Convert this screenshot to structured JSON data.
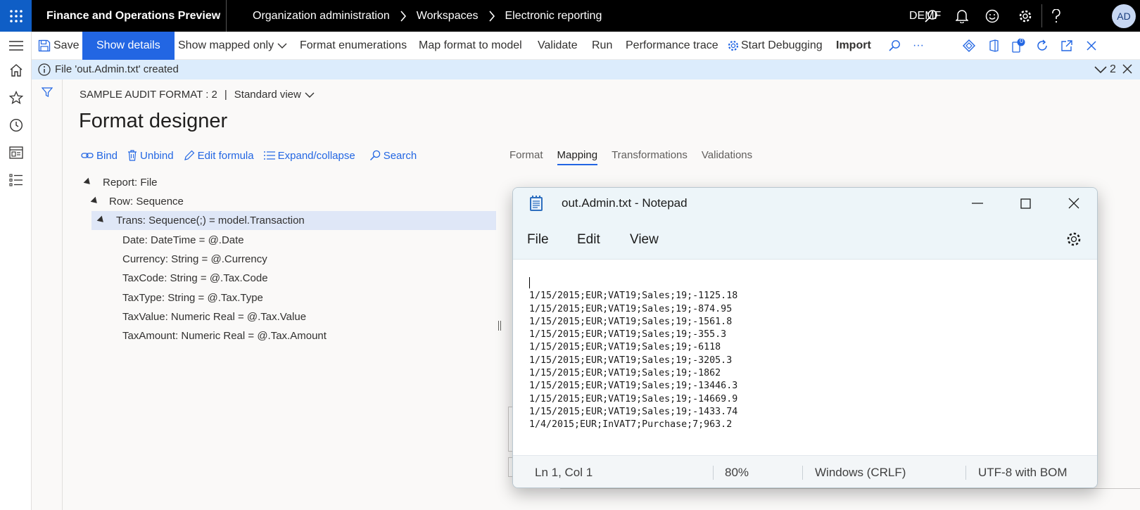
{
  "topbar": {
    "app_title": "Finance and Operations Preview",
    "breadcrumb": [
      "Organization administration",
      "Workspaces",
      "Electronic reporting"
    ],
    "company": "DEMF",
    "avatar": "AD"
  },
  "actions": {
    "save": "Save",
    "show_details": "Show details",
    "show_mapped_only": "Show mapped only",
    "format_enumerations": "Format enumerations",
    "map_format_to_model": "Map format to model",
    "validate": "Validate",
    "run": "Run",
    "performance_trace": "Performance trace",
    "start_debugging": "Start Debugging",
    "import": "Import",
    "more": "···",
    "badge_count": "0"
  },
  "message": {
    "text": "File 'out.Admin.txt' created",
    "count": "2"
  },
  "header": {
    "format_name": "SAMPLE AUDIT FORMAT : 2",
    "separator": "|",
    "view": "Standard view"
  },
  "page_title": "Format designer",
  "tree_toolbar": {
    "bind": "Bind",
    "unbind": "Unbind",
    "edit_formula": "Edit formula",
    "expand_collapse": "Expand/collapse",
    "search": "Search"
  },
  "tree": [
    {
      "label": "Report: File",
      "expanded": true
    },
    {
      "label": "Row: Sequence",
      "expanded": true
    },
    {
      "label": "Trans: Sequence(;) = model.Transaction",
      "expanded": true,
      "selected": true
    },
    {
      "label": "Date: DateTime = @.Date"
    },
    {
      "label": "Currency: String = @.Currency"
    },
    {
      "label": "TaxCode: String = @.Tax.Code"
    },
    {
      "label": "TaxType: String = @.Tax.Type"
    },
    {
      "label": "TaxValue: Numeric Real = @.Tax.Value"
    },
    {
      "label": "TaxAmount: Numeric Real = @.Tax.Amount"
    }
  ],
  "tabs": [
    {
      "label": "Format",
      "active": false
    },
    {
      "label": "Mapping",
      "active": true
    },
    {
      "label": "Transformations",
      "active": false
    },
    {
      "label": "Validations",
      "active": false
    }
  ],
  "notepad": {
    "title": "out.Admin.txt - Notepad",
    "menu": [
      "File",
      "Edit",
      "View"
    ],
    "lines": [
      "1/15/2015;EUR;VAT19;Sales;19;-1125.18",
      "1/15/2015;EUR;VAT19;Sales;19;-874.95",
      "1/15/2015;EUR;VAT19;Sales;19;-1561.8",
      "1/15/2015;EUR;VAT19;Sales;19;-355.3",
      "1/15/2015;EUR;VAT19;Sales;19;-6118",
      "1/15/2015;EUR;VAT19;Sales;19;-3205.3",
      "1/15/2015;EUR;VAT19;Sales;19;-1862",
      "1/15/2015;EUR;VAT19;Sales;19;-13446.3",
      "1/15/2015;EUR;VAT19;Sales;19;-14669.9",
      "1/15/2015;EUR;VAT19;Sales;19;-1433.74",
      "1/4/2015;EUR;InVAT7;Purchase;7;963.2"
    ],
    "status": {
      "position": "Ln 1, Col 1",
      "zoom": "80%",
      "line_ending": "Windows (CRLF)",
      "encoding": "UTF-8 with BOM"
    }
  },
  "colors": {
    "accent": "#2266e3",
    "topbar": "#000000",
    "waffle": "#0f5ec6",
    "message_bar": "#dcecfc",
    "selected_row": "#dfe7f7"
  }
}
